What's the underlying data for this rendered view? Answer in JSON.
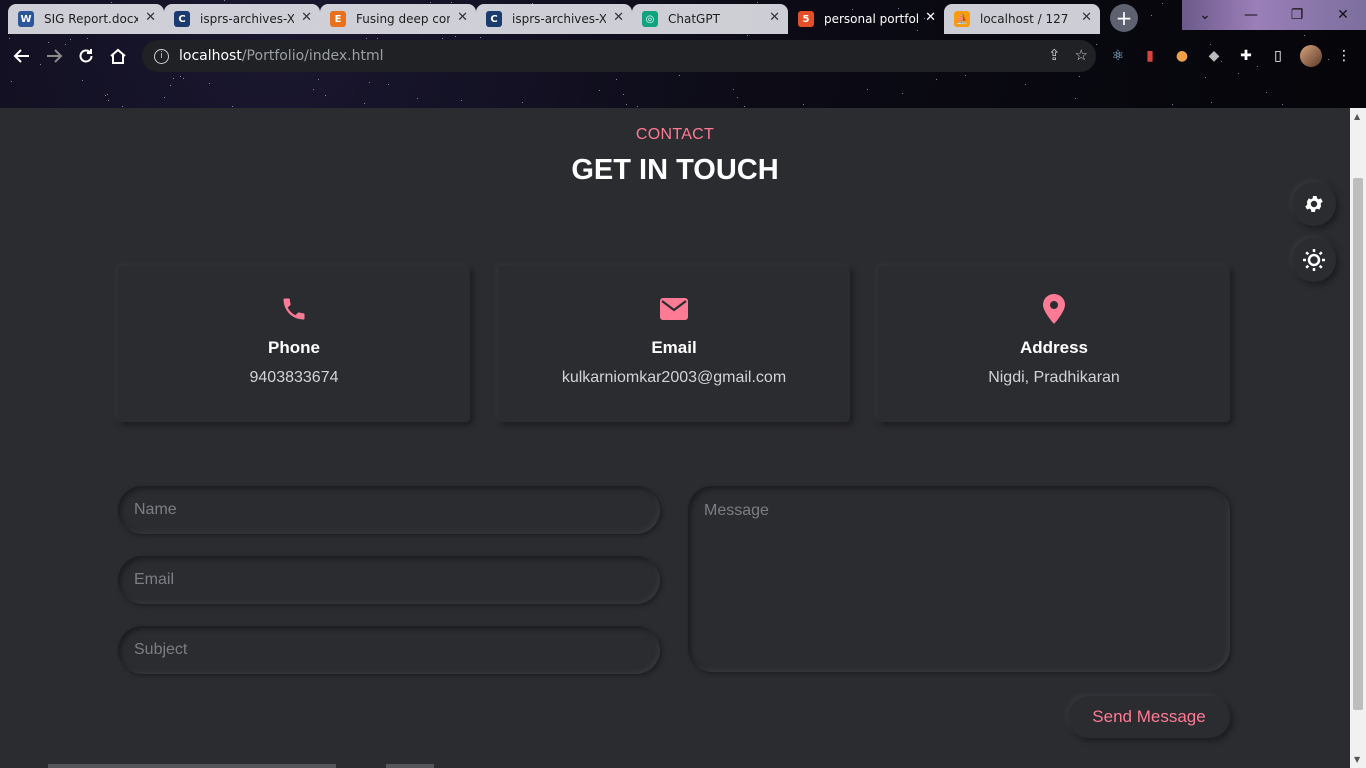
{
  "browser": {
    "tabs": [
      {
        "title": "SIG Report.docx",
        "favicon": "word-icon",
        "favicon_color": "#2b579a",
        "favicon_char": "W",
        "active": false
      },
      {
        "title": "isprs-archives-XL",
        "favicon": "isprs-icon",
        "favicon_color": "#1b3b6f",
        "favicon_char": "C",
        "active": false
      },
      {
        "title": "Fusing deep conv",
        "favicon": "elsevier-icon",
        "favicon_color": "#e9711c",
        "favicon_char": "E",
        "active": false
      },
      {
        "title": "isprs-archives-X",
        "favicon": "isprs-icon",
        "favicon_color": "#1b3b6f",
        "favicon_char": "C",
        "active": false
      },
      {
        "title": "ChatGPT",
        "favicon": "chatgpt-icon",
        "favicon_color": "#10a37f",
        "favicon_char": "◎",
        "active": false
      },
      {
        "title": "personal portfolio",
        "favicon": "html-icon",
        "favicon_color": "#e34f26",
        "favicon_char": "5",
        "active": false
      },
      {
        "title": "localhost / 127",
        "favicon": "phpmyadmin-icon",
        "favicon_color": "#f89c0e",
        "favicon_char": "⛵",
        "active": true
      }
    ],
    "url_host": "localhost",
    "url_path": "/Portfolio/index.html"
  },
  "contact": {
    "subtitle": "CONTACT",
    "title": "GET IN TOUCH",
    "accent_color": "#ff7a95",
    "cards": [
      {
        "icon": "phone-icon",
        "label": "Phone",
        "value": "9403833674"
      },
      {
        "icon": "envelope-icon",
        "label": "Email",
        "value": "kulkarniomkar2003@gmail.com"
      },
      {
        "icon": "map-pin-icon",
        "label": "Address",
        "value": "Nigdi, Pradhikaran"
      }
    ],
    "form": {
      "name_placeholder": "Name",
      "email_placeholder": "Email",
      "subject_placeholder": "Subject",
      "message_placeholder": "Message",
      "send_label": "Send Message"
    }
  },
  "floating": [
    {
      "icon": "gear-icon"
    },
    {
      "icon": "sun-icon"
    }
  ]
}
